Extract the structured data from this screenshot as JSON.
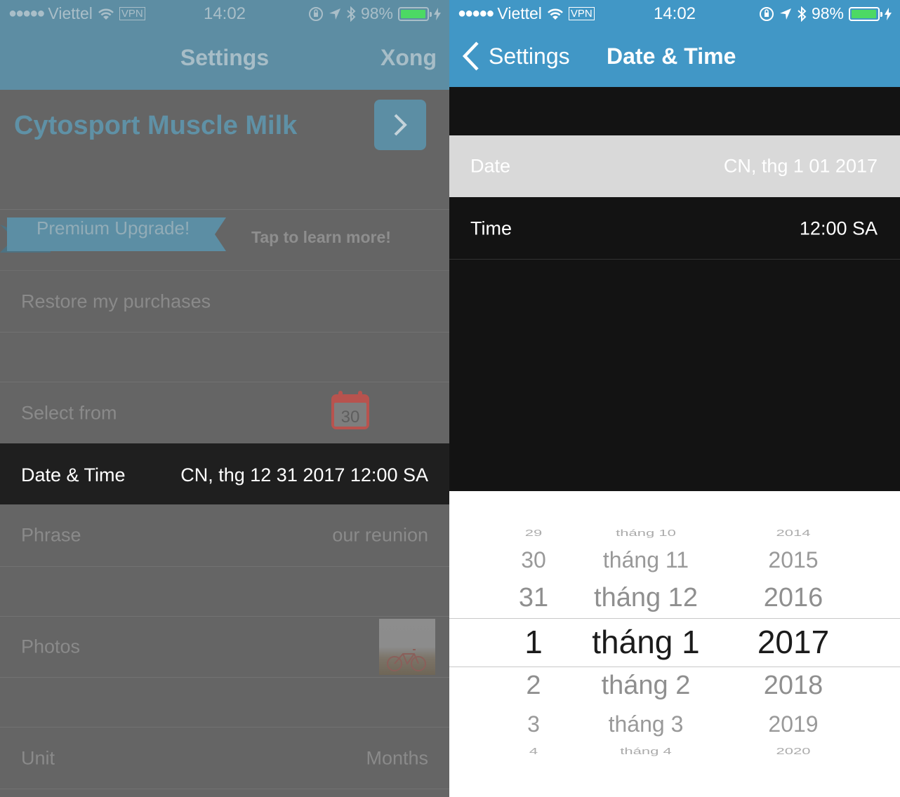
{
  "status_bar": {
    "signal": "●●●●●",
    "carrier": "Viettel",
    "vpn": "VPN",
    "time": "14:02",
    "battery": "98%",
    "battery_level": 0.98
  },
  "left": {
    "nav": {
      "title": "Settings",
      "done": "Xong"
    },
    "product": {
      "title": "Cytosport Muscle Milk"
    },
    "premium": {
      "label": "Premium Upgrade!",
      "sub": "Tap to learn more!"
    },
    "restore": "Restore my purchases",
    "select_from": {
      "label": "Select from",
      "calendar_day": "30"
    },
    "date_time": {
      "label": "Date & Time",
      "value": "CN, thg 12 31 2017 12:00 SA"
    },
    "phrase": {
      "label": "Phrase",
      "value": "our reunion"
    },
    "photos": {
      "label": "Photos"
    },
    "unit": {
      "label": "Unit",
      "value": "Months"
    }
  },
  "right": {
    "nav": {
      "back": "Settings",
      "title": "Date & Time"
    },
    "date": {
      "label": "Date",
      "value": "CN, thg 1 01 2017"
    },
    "time": {
      "label": "Time",
      "value": "12:00 SA"
    },
    "picker": {
      "day": [
        "29",
        "30",
        "31",
        "1",
        "2",
        "3",
        "4"
      ],
      "month": [
        "tháng 10",
        "tháng 11",
        "tháng 12",
        "tháng 1",
        "tháng 2",
        "tháng 3",
        "tháng 4"
      ],
      "year": [
        "2014",
        "2015",
        "2016",
        "2017",
        "2018",
        "2019",
        "2020"
      ],
      "selected_index": 3
    }
  },
  "colors": {
    "nav_blue": "#4197c6",
    "battery_green": "#4cd964",
    "picker_selected": "#1b1b1b"
  }
}
